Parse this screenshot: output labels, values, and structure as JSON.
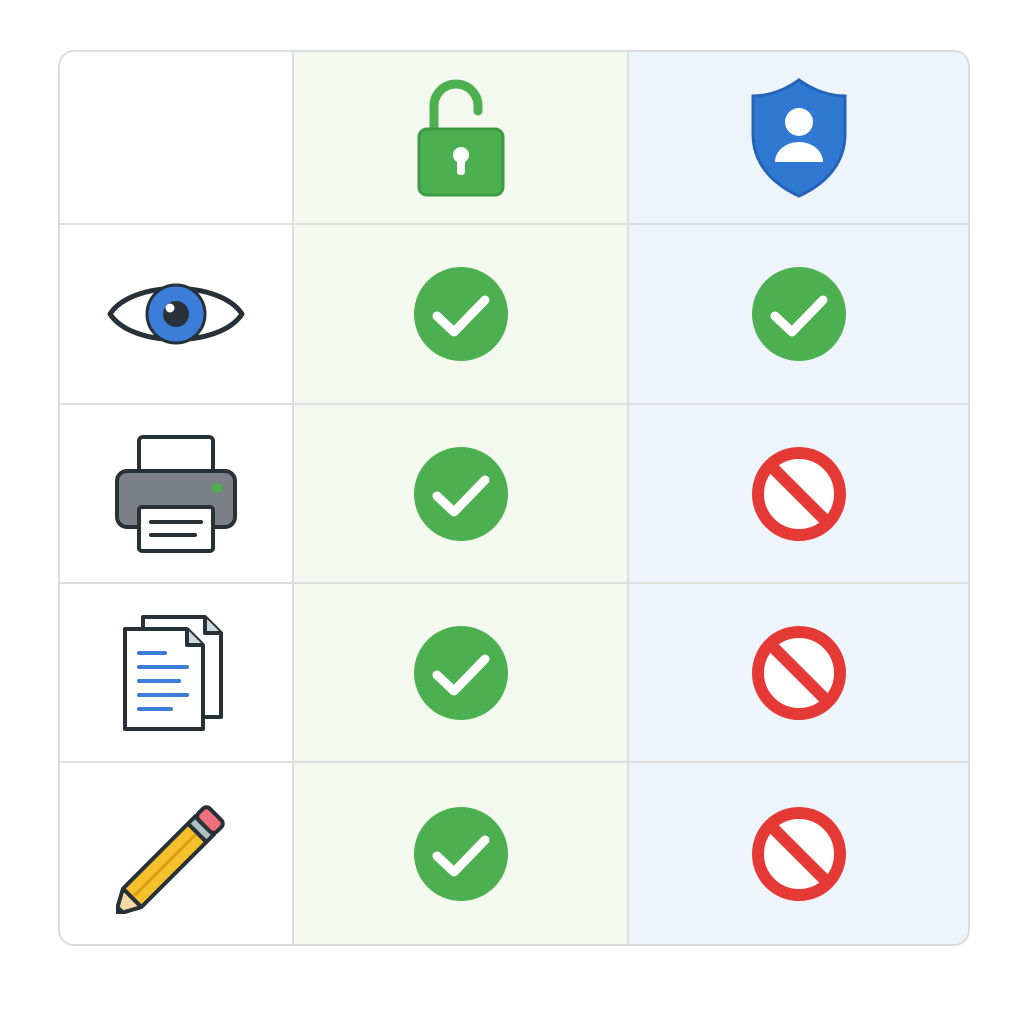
{
  "columns": [
    {
      "icon": "unlocked-padlock-icon",
      "color": "#4caf50"
    },
    {
      "icon": "user-shield-icon",
      "color": "#3079d3"
    }
  ],
  "rows": [
    {
      "permission_icon": "eye-icon",
      "cells": [
        "allowed-check-icon",
        "allowed-check-icon"
      ]
    },
    {
      "permission_icon": "printer-icon",
      "cells": [
        "allowed-check-icon",
        "prohibited-icon"
      ]
    },
    {
      "permission_icon": "copy-documents-icon",
      "cells": [
        "allowed-check-icon",
        "prohibited-icon"
      ]
    },
    {
      "permission_icon": "pencil-edit-icon",
      "cells": [
        "allowed-check-icon",
        "prohibited-icon"
      ]
    }
  ],
  "colors": {
    "allowed": "#4caf50",
    "prohibited": "#e53935",
    "open_column_bg": "#f3f9ef",
    "protected_column_bg": "#eef4fc",
    "grid_line": "#dedede"
  }
}
